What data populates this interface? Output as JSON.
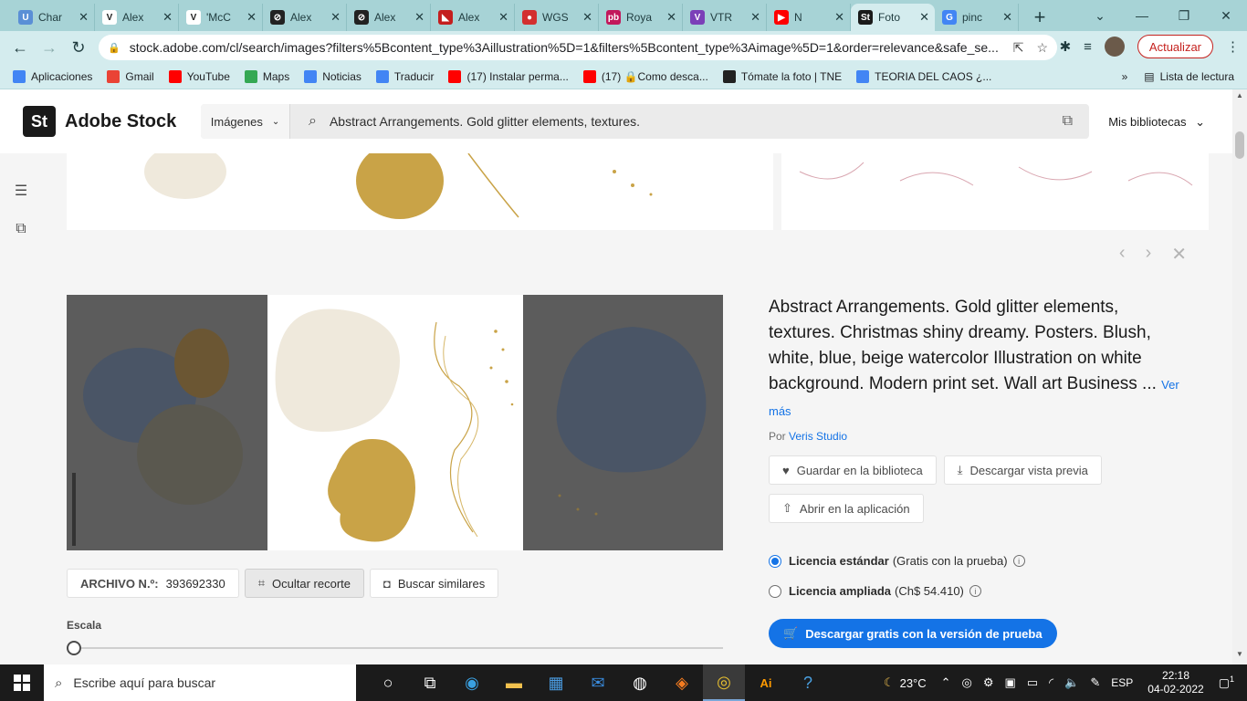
{
  "browser": {
    "tabs": [
      {
        "title": "Char",
        "color": "#5a8fd6",
        "glyph": "U"
      },
      {
        "title": "Alex",
        "color": "#ffffff",
        "glyph": "V"
      },
      {
        "title": "'McC",
        "color": "#ffffff",
        "glyph": "V"
      },
      {
        "title": "Alex",
        "color": "#222222",
        "glyph": "⊘"
      },
      {
        "title": "Alex",
        "color": "#222222",
        "glyph": "⊘"
      },
      {
        "title": "Alex",
        "color": "#c41e1e",
        "glyph": "◣"
      },
      {
        "title": "WGS",
        "color": "#d32f2f",
        "glyph": "●"
      },
      {
        "title": "Roya",
        "color": "#c2185b",
        "glyph": "pb"
      },
      {
        "title": "VTR",
        "color": "#7b3fb8",
        "glyph": "V"
      },
      {
        "title": "N",
        "color": "#ff0000",
        "glyph": "▶"
      },
      {
        "title": "Foto",
        "color": "#1a1a1a",
        "glyph": "St",
        "active": true
      },
      {
        "title": "pinc",
        "color": "#4285f4",
        "glyph": "G"
      }
    ],
    "new_tab": "+",
    "window": {
      "dropdown": "⌄",
      "minimize": "—",
      "restore": "❐",
      "close": "✕"
    },
    "nav": {
      "back": "←",
      "forward": "→",
      "reload": "↻"
    },
    "url": "stock.adobe.com/cl/search/images?filters%5Bcontent_type%3Aillustration%5D=1&filters%5Bcontent_type%3Aimage%5D=1&order=relevance&safe_se...",
    "update_label": "Actualizar",
    "bookmarks": [
      {
        "label": "Aplicaciones",
        "color": "#4285f4"
      },
      {
        "label": "Gmail",
        "color": "#ea4335"
      },
      {
        "label": "YouTube",
        "color": "#ff0000"
      },
      {
        "label": "Maps",
        "color": "#34a853"
      },
      {
        "label": "Noticias",
        "color": "#4285f4"
      },
      {
        "label": "Traducir",
        "color": "#4285f4"
      },
      {
        "label": "(17) Instalar perma...",
        "color": "#ff0000"
      },
      {
        "label": "(17) 🔒Como desca...",
        "color": "#ff0000"
      },
      {
        "label": "Tómate la foto | TNE",
        "color": "#222222"
      },
      {
        "label": "TEORIA DEL CAOS ¿...",
        "color": "#4285f4"
      }
    ],
    "more_bookmarks": "»",
    "reading_list": "Lista de lectura"
  },
  "stock": {
    "logo_mark": "St",
    "logo_text": "Adobe Stock",
    "filter_type": "Imágenes",
    "search_query": "Abstract Arrangements. Gold glitter elements, textures.",
    "my_libraries": "Mis bibliotecas"
  },
  "detail": {
    "description": "Abstract Arrangements. Gold glitter elements, textures. Christmas shiny dreamy. Posters. Blush, white, blue, beige watercolor Illustration on white background. Modern print set. Wall art Business ...",
    "see_more": "Ver más",
    "author_prefix": "Por",
    "author": "Veris Studio",
    "save_library": "Guardar en la biblioteca",
    "download_preview": "Descargar vista previa",
    "open_app": "Abrir en la aplicación",
    "file_label": "ARCHIVO N.º:",
    "file_number": "393692330",
    "hide_crop": "Ocultar recorte",
    "find_similar": "Buscar similares",
    "scale_label": "Escala",
    "scale_value": 0,
    "license_standard": "Licencia estándar",
    "license_standard_note": "(Gratis con la prueba)",
    "license_extended": "Licencia ampliada",
    "license_extended_note": "(Ch$ 54.410)",
    "cta": "Descargar gratis con la versión de prueba"
  },
  "taskbar": {
    "search_placeholder": "Escribe aquí para buscar",
    "weather": "23°C",
    "language": "ESP",
    "time": "22:18",
    "date": "04-02-2022",
    "notifications": "1"
  }
}
